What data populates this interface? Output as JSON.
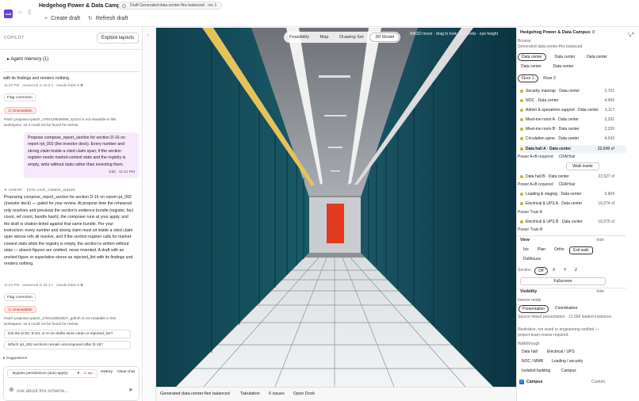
{
  "app": {
    "logo_text": "null",
    "title": "Hedgehog Power & Data Campus",
    "draft_chip": "Draft Generated data-center-flex balanced · rev 1"
  },
  "toolbar": {
    "create_draft": "Create draft",
    "refresh_draft": "Refresh draft"
  },
  "copilot": {
    "label": "COPILOT",
    "explore_layouts": "Explore layouts",
    "agent_memory": "Agent memory (1)",
    "msg1_tail": "with its findings and renders nothing.",
    "msg1_meta": "11:20 PM · answered in 16.6 s · claude-fable-5",
    "flag_correction": "Flag correction",
    "unavailable": "Unavailable",
    "patch1": "Patch proposal cpatch_1784128849069_vy31si is not readable in this workspace, so it could not be found for review.",
    "user_msg": "Propose compose_report_section for section D-16 on report rpt_002 (the investor deck). Every number and strong claim inside a cited claim span; if the section register needs market-context stats and the registry is empty, write without stats rather than inventing them.",
    "user_edit": "Edit",
    "user_time": "11:21 PM",
    "agent_label": "AGENT · FOR USR_ADMIN_DEMO",
    "agent_reply": "Proposing compose_report_section for section D-16 on report rpt_002 (investor deck) — gated for your review. At propose time the rehearsal only resolves and previews the section's evidence bundle (register, fact count, ref count, bundle hash); the composer runs at your apply, and the draft is citation-linted against that same bundle. Per your instruction: every number and strong claim must sit inside a cited claim span whose refs all resolve, and if the section register calls for market-context stats while the registry is empty, the section is written without stats — absent figures are omitted, never invented. A draft with an uncited figure or superlative stores as rejected_lint with its findings and renders nothing.",
    "msg2_meta": "11:21 PM · answered in 22.3 s · claude-fable-5",
    "patch2": "Patch proposal cpatch_1784128902827_gdh4h is not readable in this workspace, so it could not be found for review.",
    "suggest1": "Did the D-02, D-04, or D-15 drafts store clean or rejected_lint?",
    "suggest2": "Which rpt_002 sections remain uncomposed after D-16?",
    "suggestions": "Suggestions",
    "permissions": "Bypass permissions (auto-apply)",
    "ap": "ap...",
    "history": "History",
    "clear_chat": "Clear chat",
    "placeholder": "Ask about this scheme..."
  },
  "viewport": {
    "tabs": [
      "Feasibility",
      "Map",
      "Drawing Set",
      "3D Model"
    ],
    "active_tab": "3D Model",
    "hint": "WASD move · drag to look · Esc exits · eye height"
  },
  "bottombar": {
    "scheme": "Generated data-center-flex balanced",
    "tabulation": "Tabulation",
    "issues": "6 issues",
    "open_dock": "Open Dock"
  },
  "rightpanel": {
    "title": "Hedgehog Power & Data Campus",
    "browse": "Browse",
    "subtitle": "Generated data-center-flex balanced",
    "type_chips": [
      "Data center",
      "Data center",
      "Data center",
      "Data center",
      "Data center"
    ],
    "floors": [
      "Floor 1",
      "Floor 2"
    ],
    "rooms": [
      {
        "name": "Security mantrap · Data center",
        "size": "2,701",
        "color": "#c9b037"
      },
      {
        "name": "NOC · Data center",
        "size": "4,499",
        "color": "#c9b037"
      },
      {
        "name": "Admin & operations support · Data center",
        "size": "3,117",
        "color": "#c9b037"
      },
      {
        "name": "Meet-me room A · Data center",
        "size": "2,332",
        "color": "#c9b037"
      },
      {
        "name": "Meet-me room B · Data center",
        "size": "2,339",
        "color": "#c9b037"
      },
      {
        "name": "Circulation spine · Data center",
        "size": "4,043",
        "color": "#c9b037"
      },
      {
        "name": "Data hall A · Data center",
        "size": "22,549 sf",
        "color": "#d8a21f"
      },
      {
        "name": "Data hall B · Data center",
        "size": "22,527 sf",
        "color": "#c9b037"
      },
      {
        "name": "Loading & staging · Data center",
        "size": "3,904",
        "color": "#c9b037"
      },
      {
        "name": "Electrical & UPS A · Data center",
        "size": "16,074 sf",
        "color": "#c9b037"
      },
      {
        "name": "Electrical & UPS B · Data center",
        "size": "16,075 sf",
        "color": "#c9b037"
      }
    ],
    "power_ab": "Power A+B required",
    "crah": "CRAH/air",
    "walk_inside": "Walk inside",
    "power_train_a": "Power Train A",
    "power_train_b": "Power Train B",
    "view_label": "View",
    "hide": "hide",
    "view_modes": [
      "Iso",
      "Plan",
      "Ortho",
      "Exit walk"
    ],
    "dollhouse": "Dollhouse",
    "section_label": "Section",
    "section_opts": [
      "Off",
      "X",
      "Y",
      "Z"
    ],
    "fullscreen": "Fullscreen",
    "visibility": "Visibility",
    "interior_mode": "Interior mode",
    "presentation": "Presentation",
    "coordination": "Coordination",
    "source_note": "Source-linked presentation · 12,568 loaded instances",
    "illustrative": "Illustrative, not sized or engineering verified — project-team review required.",
    "walkthrough": "Walkthrough",
    "walk_chips": [
      "Data hall",
      "Electrical / UPS",
      "NOC / MMR",
      "Loading / security",
      "Isolated building",
      "Campus"
    ],
    "campus_check": "Campus",
    "custom": "Custom"
  },
  "colors": {
    "accent": "#6b3fd6",
    "user_bubble": "#f7e8fb",
    "unavailable_bg": "#fde8e4",
    "cable_tray": "#e6c35a",
    "red_door": "#e03a1f"
  }
}
